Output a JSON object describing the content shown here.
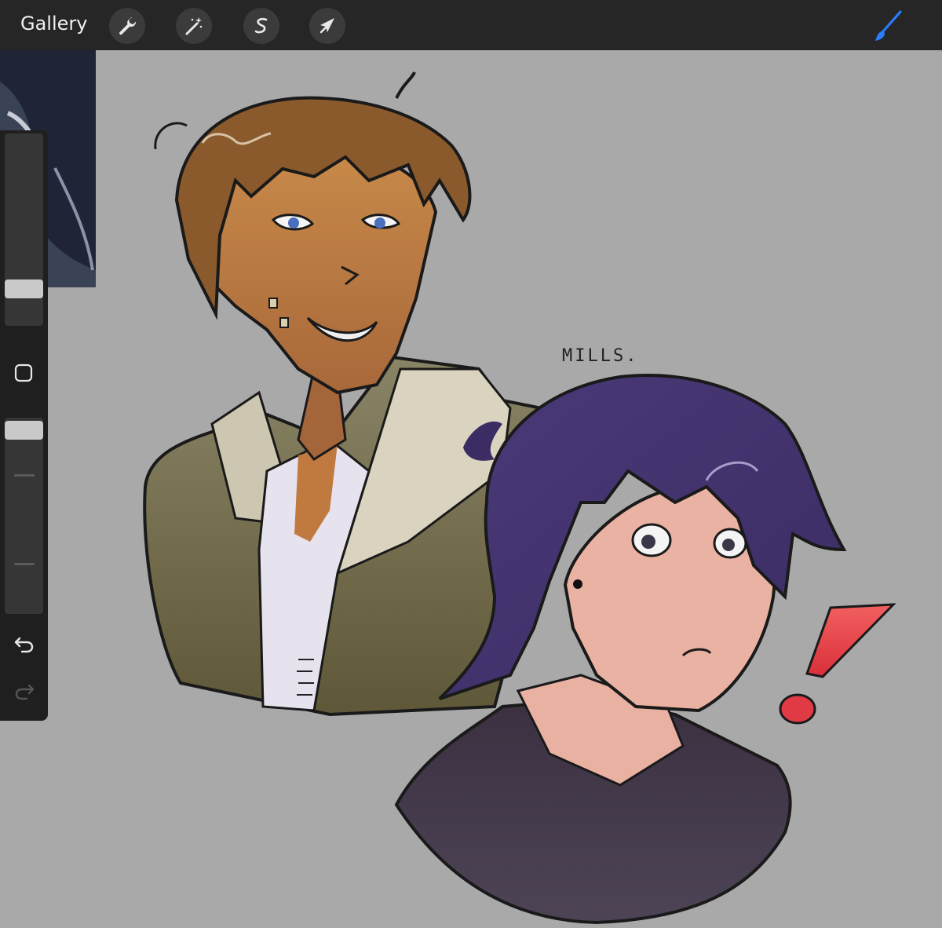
{
  "toolbar": {
    "gallery_label": "Gallery",
    "tools": [
      {
        "name": "actions",
        "icon": "wrench-icon"
      },
      {
        "name": "adjustments",
        "icon": "magic-wand-icon"
      },
      {
        "name": "selection",
        "icon": "selection-s-icon"
      },
      {
        "name": "transform",
        "icon": "arrow-cursor-icon"
      }
    ],
    "active_tool": {
      "name": "brush",
      "icon": "brush-icon",
      "color": "#2a7cf7"
    }
  },
  "canvas": {
    "background": "#a9a9a9",
    "annotation_text": "MILLS."
  },
  "sidebar": {
    "brush_size_level": 0.22,
    "opacity_level": 1.0,
    "modify_icon": "square-modify-icon",
    "undo_icon": "undo-arrow-icon",
    "redo_icon": "redo-arrow-icon",
    "redo_enabled": false
  }
}
